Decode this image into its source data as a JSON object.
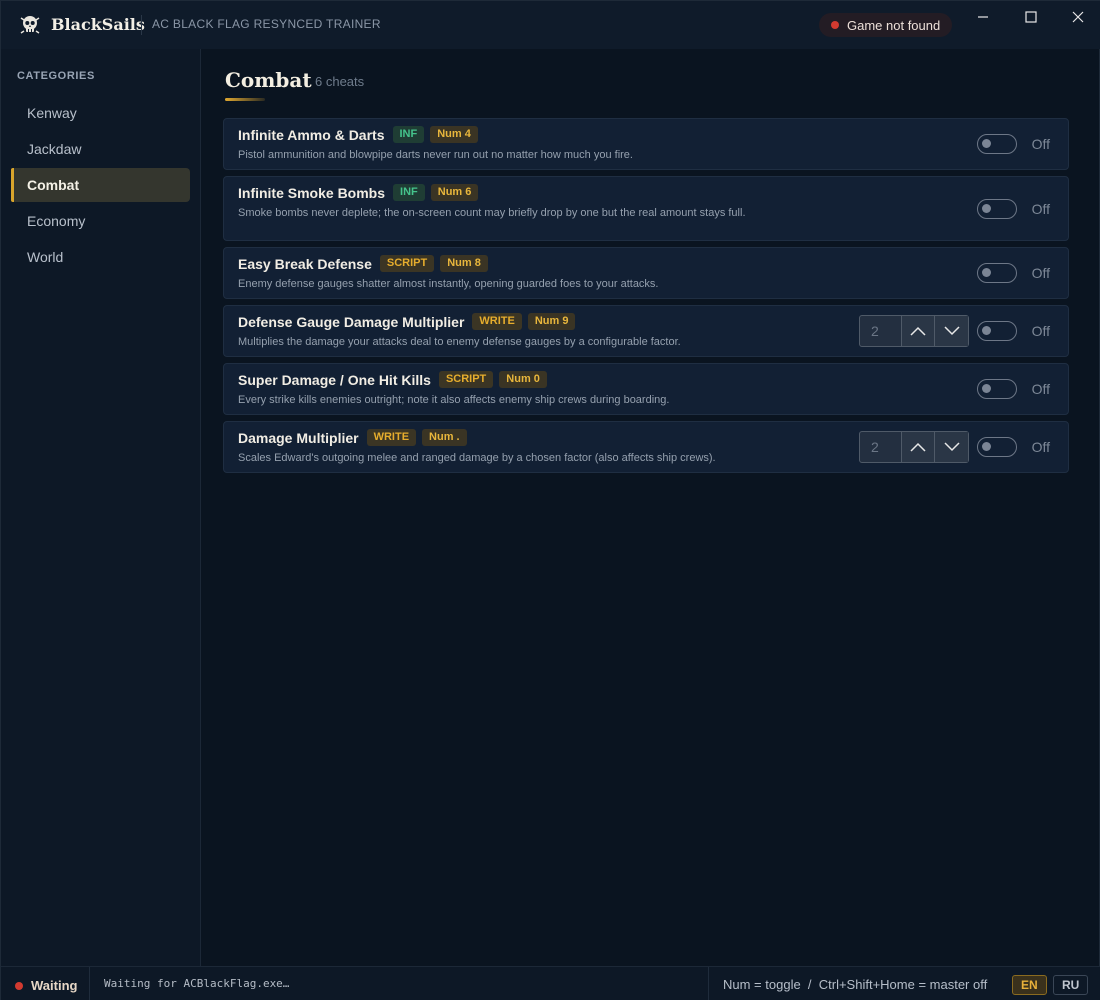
{
  "app": {
    "name": "BlackSails",
    "subtitle": "AC BLACK FLAG RESYNCED TRAINER",
    "game_status": "Game not found",
    "accent_color": "#d9a52c",
    "status_color": "#d23a30"
  },
  "window_controls": {
    "minimize_icon": "minimize-icon",
    "maximize_icon": "maximize-icon",
    "close_icon": "close-icon"
  },
  "sidebar": {
    "heading": "CATEGORIES",
    "items": [
      {
        "label": "Kenway",
        "active": false
      },
      {
        "label": "Jackdaw",
        "active": false
      },
      {
        "label": "Combat",
        "active": true
      },
      {
        "label": "Economy",
        "active": false
      },
      {
        "label": "World",
        "active": false
      }
    ]
  },
  "main": {
    "title": "Combat",
    "count": "6 cheats",
    "cheats": [
      {
        "name": "Infinite Ammo & Darts",
        "type": "INF",
        "hotkey": "Num 4",
        "description": "Pistol ammunition and blowpipe darts never run out no matter how much you fire.",
        "state": "Off"
      },
      {
        "name": "Infinite Smoke Bombs",
        "type": "INF",
        "hotkey": "Num 6",
        "description": "Smoke bombs never deplete; the on-screen count may briefly drop by one but the real amount stays full.",
        "state": "Off"
      },
      {
        "name": "Easy Break Defense",
        "type": "SCRIPT",
        "hotkey": "Num 8",
        "description": "Enemy defense gauges shatter almost instantly, opening guarded foes to your attacks.",
        "state": "Off"
      },
      {
        "name": "Defense Gauge Damage Multiplier",
        "type": "WRITE",
        "hotkey": "Num 9",
        "description": "Multiplies the damage your attacks deal to enemy defense gauges by a configurable factor.",
        "value": "2",
        "state": "Off"
      },
      {
        "name": "Super Damage / One Hit Kills",
        "type": "SCRIPT",
        "hotkey": "Num 0",
        "description": "Every strike kills enemies outright; note it also affects enemy ship crews during boarding.",
        "state": "Off"
      },
      {
        "name": "Damage Multiplier",
        "type": "WRITE",
        "hotkey": "Num .",
        "description": "Scales Edward's outgoing melee and ranged damage by a chosen factor (also affects ship crews).",
        "value": "2",
        "state": "Off"
      }
    ]
  },
  "statusbar": {
    "state": "Waiting",
    "message": "Waiting for ACBlackFlag.exe…",
    "hint": "Num = toggle  /  Ctrl+Shift+Home = master off",
    "languages": [
      "EN",
      "RU"
    ],
    "active_language": "EN"
  }
}
